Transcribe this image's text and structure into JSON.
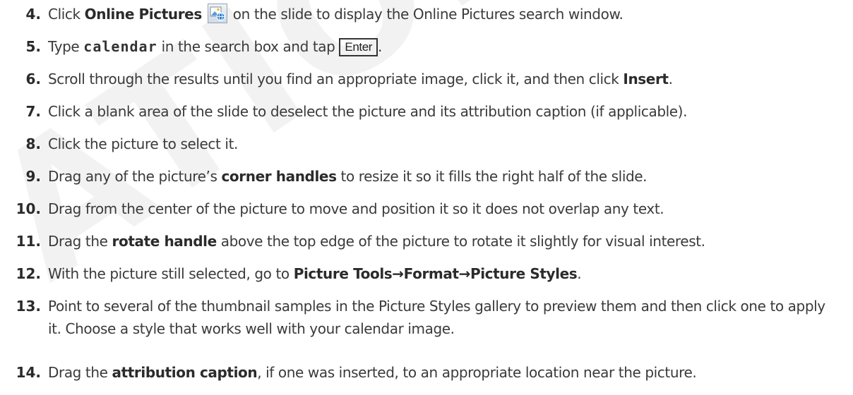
{
  "watermark": "ATION",
  "steps": [
    {
      "num": "4.",
      "parts": {
        "a": "Click ",
        "b": "Online Pictures",
        "c": " on the slide to display the Online Pictures search window."
      }
    },
    {
      "num": "5.",
      "parts": {
        "a": "Type ",
        "code": "calendar",
        "c": " in the search box and tap ",
        "key": "Enter",
        "d": "."
      }
    },
    {
      "num": "6.",
      "parts": {
        "a": "Scroll through the results until you find an appropriate image, click it, and then click ",
        "b": "Insert",
        "c": "."
      }
    },
    {
      "num": "7.",
      "parts": {
        "a": "Click a blank area of the slide to deselect the picture and its attribution caption (if applicable)."
      }
    },
    {
      "num": "8.",
      "parts": {
        "a": "Click the picture to select it."
      }
    },
    {
      "num": "9.",
      "parts": {
        "a": "Drag any of the picture’s ",
        "b": "corner handles",
        "c": " to resize it so it fills the right half of the slide."
      }
    },
    {
      "num": "10.",
      "parts": {
        "a": "Drag from the center of the picture to move and position it so it does not overlap any text."
      }
    },
    {
      "num": "11.",
      "parts": {
        "a": "Drag the ",
        "b": "rotate handle",
        "c": " above the top edge of the picture to rotate it slightly for visual interest."
      }
    },
    {
      "num": "12.",
      "parts": {
        "a": "With the picture still selected, go to ",
        "b": "Picture Tools→Format→Picture Styles",
        "c": "."
      }
    },
    {
      "num": "13.",
      "parts": {
        "a": "Point to several of the thumbnail samples in the Picture Styles gallery to preview them and then click one to apply it. Choose a style that works well with your calendar image."
      }
    },
    {
      "num": "14.",
      "parts": {
        "a": "Drag the ",
        "b": "attribution caption",
        "c": ", if one was inserted, to an appropriate location near the picture."
      }
    }
  ],
  "icons": {
    "online_pictures": "online-pictures-icon"
  },
  "colors": {
    "text": "#3a3a3a",
    "bold": "#2b2b2b",
    "watermark": "#f2f2f2"
  }
}
